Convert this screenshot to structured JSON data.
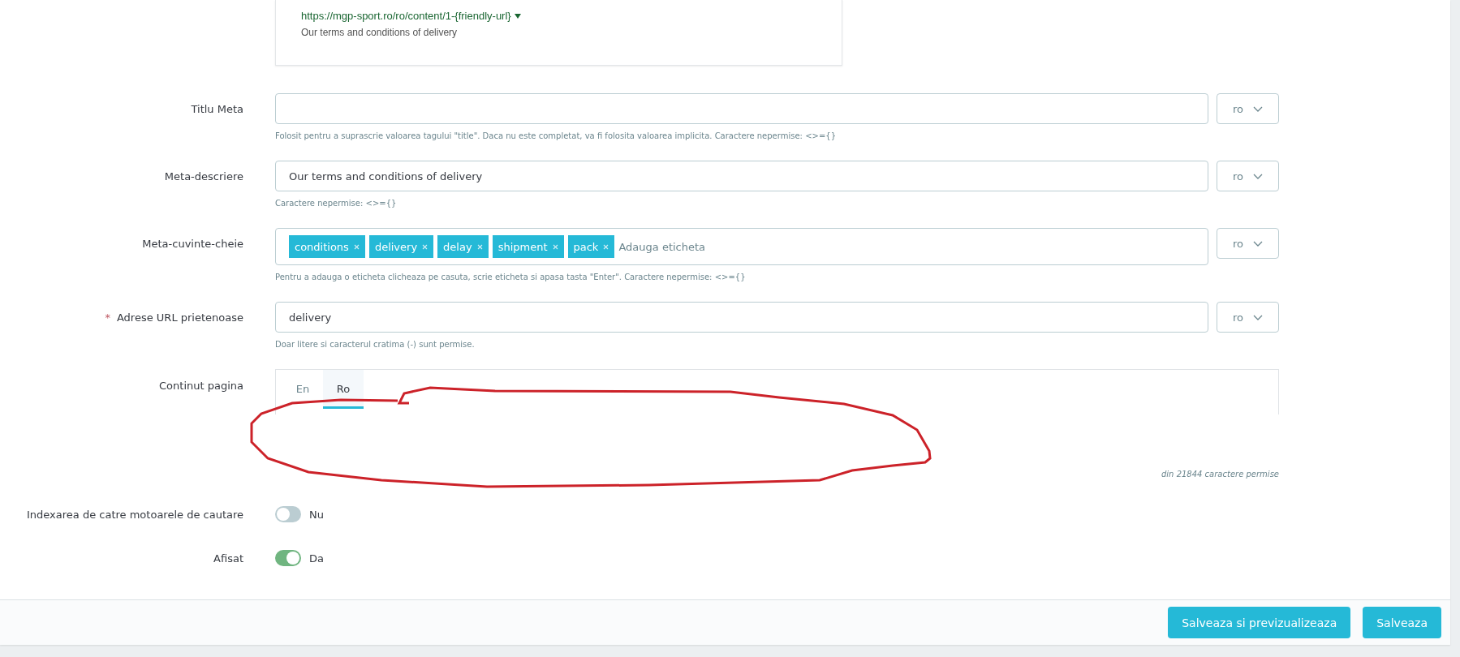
{
  "preview": {
    "url": "https://mgp-sport.ro/ro/content/1-{friendly-url}",
    "description": "Our terms and conditions of delivery"
  },
  "fields": [
    {
      "kind": "text",
      "label": "Titlu Meta",
      "help": "Folosit pentru a suprascrie valoarea tagului \"title\". Daca nu este completat, va fi folosita valoarea implicita. Caractere nepermise: <>={}",
      "language": "ro"
    },
    {
      "kind": "text",
      "label": "Meta-descriere",
      "value": "Our terms and conditions of delivery",
      "help": "Caractere nepermise: <>={}",
      "language": "ro"
    },
    {
      "kind": "tags",
      "label": "Meta-cuvinte-cheie",
      "tags": [
        "conditions",
        "delivery",
        "delay",
        "shipment",
        "pack"
      ],
      "placeholder": "Adauga eticheta",
      "help": "Pentru a adauga o eticheta clicheaza pe casuta, scrie eticheta si apasa tasta \"Enter\". Caractere nepermise: <>={}",
      "language": "ro"
    },
    {
      "kind": "text",
      "label": "Adrese URL prietenoase",
      "required_mark": "*",
      "value": "delivery",
      "help": "Doar litere si caracterul cratima (-) sunt permise.",
      "language": "ro"
    }
  ],
  "content": {
    "label": "Continut pagina",
    "tabs": [
      {
        "label": "En",
        "selected": false
      },
      {
        "label": "Ro",
        "selected": true
      }
    ],
    "counter": "din 21844 caractere permise"
  },
  "switches": [
    {
      "label": "Indexarea de catre motoarele de cautare",
      "on": false,
      "text": "Nu"
    },
    {
      "label": "Afisat",
      "on": true,
      "text": "Da"
    }
  ],
  "buttons": [
    "Salveaza si previzualizeaza",
    "Salveaza"
  ]
}
